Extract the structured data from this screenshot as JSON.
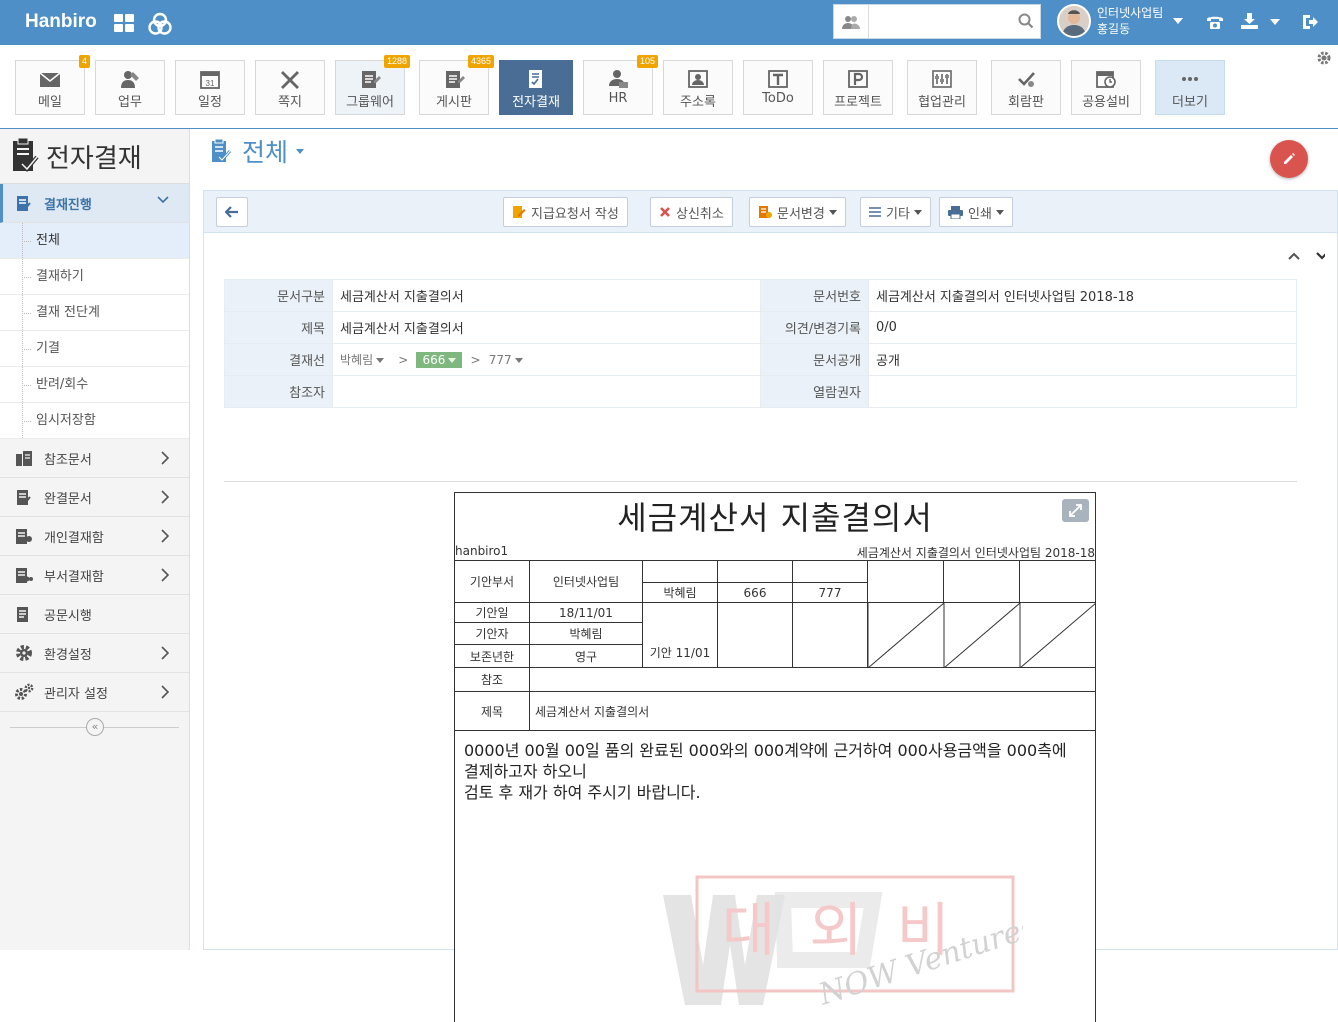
{
  "topbar": {
    "brand": "Hanbiro",
    "search_placeholder": "",
    "user": {
      "dept": "인터넷사업팀",
      "name": "홍길동"
    }
  },
  "apps": [
    {
      "label": "메일",
      "icon": "mail-icon",
      "badge": "4"
    },
    {
      "label": "업무",
      "icon": "task-icon",
      "badge": ""
    },
    {
      "label": "일정",
      "icon": "calendar-icon",
      "badge": ""
    },
    {
      "label": "쪽지",
      "icon": "message-icon",
      "badge": ""
    },
    {
      "label": "그룹웨어",
      "icon": "groupware-icon",
      "badge": "1288"
    },
    {
      "label": "게시판",
      "icon": "board-icon",
      "badge": "4365"
    },
    {
      "label": "전자결재",
      "icon": "approval-icon",
      "badge": ""
    },
    {
      "label": "HR",
      "icon": "hr-icon",
      "badge": "105"
    },
    {
      "label": "주소록",
      "icon": "contacts-icon",
      "badge": ""
    },
    {
      "label": "ToDo",
      "icon": "todo-icon",
      "badge": ""
    },
    {
      "label": "프로젝트",
      "icon": "project-icon",
      "badge": ""
    },
    {
      "label": "협업관리",
      "icon": "collab-icon",
      "badge": ""
    },
    {
      "label": "회람판",
      "icon": "circular-icon",
      "badge": ""
    },
    {
      "label": "공용설비",
      "icon": "facility-icon",
      "badge": ""
    },
    {
      "label": "더보기",
      "icon": "more-icon",
      "badge": ""
    }
  ],
  "sidebar": {
    "title": "전자결재",
    "open_menu": "결재진행",
    "sub_items": [
      "전체",
      "결재하기",
      "결재 전단계",
      "기결",
      "반려/회수",
      "임시저장함"
    ],
    "menus": [
      "참조문서",
      "완결문서",
      "개인결재함",
      "부서결재함",
      "공문시행",
      "환경설정",
      "관리자 설정"
    ]
  },
  "main": {
    "page_title": "전체",
    "toolbar": {
      "write": "지급요청서 작성",
      "cancel": "상신취소",
      "change": "문서변경",
      "etc": "기타",
      "print": "인쇄"
    },
    "info": {
      "doc_type_label": "문서구분",
      "doc_type": "세금계산서 지출결의서",
      "doc_no_label": "문서번호",
      "doc_no": "세금계산서 지출결의서 인터넷사업팀 2018-18",
      "subject_label": "제목",
      "subject": "세금계산서 지출결의서",
      "opinion_label": "의견/변경기록",
      "opinion": "0/0",
      "line_label": "결재선",
      "line": [
        "박혜림",
        "666",
        "777"
      ],
      "line_sep": ">",
      "public_label": "문서공개",
      "public": "공개",
      "ref_label": "참조자",
      "ref": "",
      "viewer_label": "열람권자",
      "viewer": ""
    },
    "doc": {
      "title": "세금계산서 지출결의서",
      "company": "hanbiro1",
      "doc_no": "세금계산서 지출결의서 인터넷사업팀 2018-18",
      "dept_label": "기안부서",
      "dept": "인터넷사업팀",
      "date_label": "기안일",
      "date": "18/11/01",
      "drafter_label": "기안자",
      "drafter": "박혜림",
      "retention_label": "보존년한",
      "retention": "영구",
      "approvers": [
        "박혜림",
        "666",
        "777"
      ],
      "draft_stamp": "기안 11/01",
      "ref_label": "참조",
      "ref": "",
      "subject_label": "제목",
      "subject": "세금계산서 지출결의서",
      "body": [
        "0000년 00월 00일 품의 완료된 000와의 000계약에 근거하여 000사용금액을 000측에 결제하고자 하오니",
        "검토 후 재가 하여 주시기 바랍니다."
      ]
    },
    "watermark": {
      "text": "대외비",
      "brand": "NOW Ventures"
    }
  },
  "colors": {
    "topbar": "#4d8fc6",
    "active_app": "#4a6d96",
    "fab": "#d9534f",
    "badge": "#f0a400",
    "line_highlight": "#7fb87f"
  }
}
